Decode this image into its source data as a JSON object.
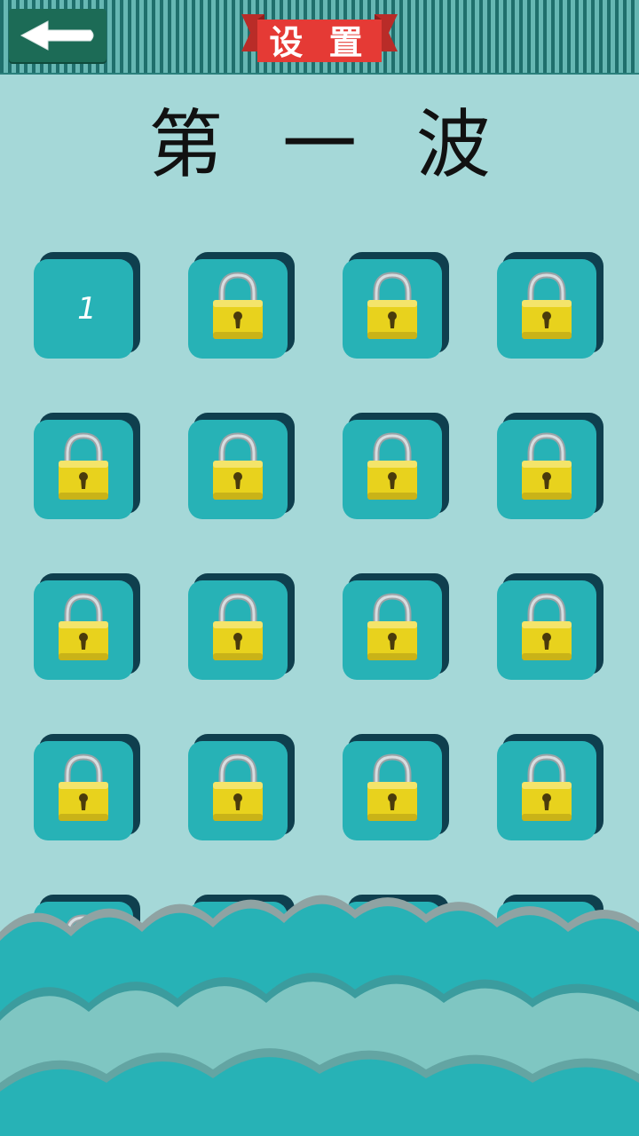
{
  "header": {
    "back_icon": "arrow-left-icon",
    "settings_label": "设 置",
    "ribbon_color": "#e53a35"
  },
  "title": "第 一 波",
  "colors": {
    "background": "#a5d8d8",
    "tile_face": "#27b2b6",
    "tile_shadow": "#0f3f4e",
    "lock": "#e8d21d",
    "wave": "#27b2b6"
  },
  "levels": [
    {
      "label": "1",
      "locked": false
    },
    {
      "label": "",
      "locked": true
    },
    {
      "label": "",
      "locked": true
    },
    {
      "label": "",
      "locked": true
    },
    {
      "label": "",
      "locked": true
    },
    {
      "label": "",
      "locked": true
    },
    {
      "label": "",
      "locked": true
    },
    {
      "label": "",
      "locked": true
    },
    {
      "label": "",
      "locked": true
    },
    {
      "label": "",
      "locked": true
    },
    {
      "label": "",
      "locked": true
    },
    {
      "label": "",
      "locked": true
    },
    {
      "label": "",
      "locked": true
    },
    {
      "label": "",
      "locked": true
    },
    {
      "label": "",
      "locked": true
    },
    {
      "label": "",
      "locked": true
    },
    {
      "label": "",
      "locked": true
    },
    {
      "label": "",
      "locked": true
    },
    {
      "label": "",
      "locked": true
    },
    {
      "label": "",
      "locked": true
    }
  ]
}
